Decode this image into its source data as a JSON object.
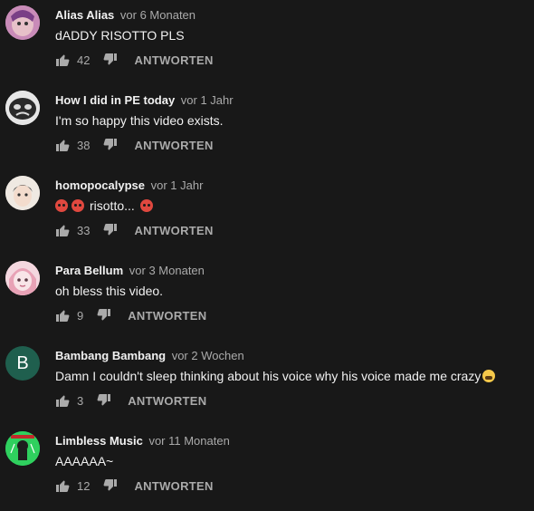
{
  "comments": [
    {
      "author": "Alias Alias",
      "time": "vor 6 Monaten",
      "text": "dADDY RISOTTO PLS",
      "likes": "42",
      "reply": "ANTWORTEN"
    },
    {
      "author": "How I did in PE today",
      "time": "vor 1 Jahr",
      "text": "I'm so happy this video exists.",
      "likes": "38",
      "reply": "ANTWORTEN"
    },
    {
      "author": "homopocalypse",
      "time": "vor 1 Jahr",
      "text": "risotto...",
      "likes": "33",
      "reply": "ANTWORTEN"
    },
    {
      "author": "Para Bellum",
      "time": "vor 3 Monaten",
      "text": "oh bless this video.",
      "likes": "9",
      "reply": "ANTWORTEN"
    },
    {
      "author": "Bambang Bambang",
      "time": "vor 2 Wochen",
      "text": "Damn I couldn't sleep thinking about his voice why his voice made me crazy",
      "likes": "3",
      "reply": "ANTWORTEN",
      "avatar_letter": "B"
    },
    {
      "author": "Limbless Music",
      "time": "vor 11 Monaten",
      "text": "AAAAAA~",
      "likes": "12",
      "reply": "ANTWORTEN"
    }
  ],
  "colors": {
    "background": "#181818",
    "text": "#f1f1f1",
    "muted": "#aaaaaa",
    "avatar_b": "#1f5f4e"
  }
}
